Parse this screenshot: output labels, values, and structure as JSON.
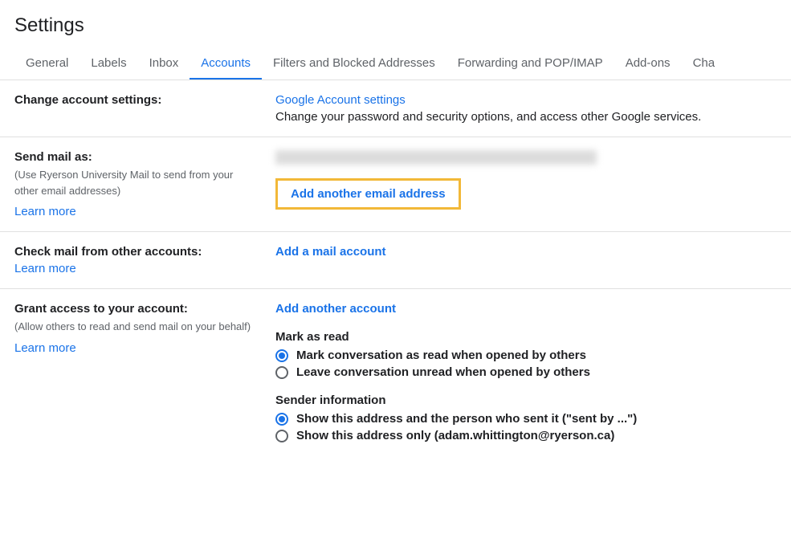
{
  "page_title": "Settings",
  "tabs": [
    {
      "label": "General",
      "active": false
    },
    {
      "label": "Labels",
      "active": false
    },
    {
      "label": "Inbox",
      "active": false
    },
    {
      "label": "Accounts",
      "active": true
    },
    {
      "label": "Filters and Blocked Addresses",
      "active": false
    },
    {
      "label": "Forwarding and POP/IMAP",
      "active": false
    },
    {
      "label": "Add-ons",
      "active": false
    },
    {
      "label": "Cha",
      "active": false
    }
  ],
  "change_account": {
    "title": "Change account settings:",
    "link": "Google Account settings",
    "desc": "Change your password and security options, and access other Google services."
  },
  "send_mail_as": {
    "title": "Send mail as:",
    "subtext": "(Use Ryerson University Mail to send from your other email addresses)",
    "learn_more": "Learn more",
    "add_link": "Add another email address"
  },
  "check_mail": {
    "title": "Check mail from other accounts:",
    "learn_more": "Learn more",
    "add_link": "Add a mail account"
  },
  "grant_access": {
    "title": "Grant access to your account:",
    "subtext": "(Allow others to read and send mail on your behalf)",
    "learn_more": "Learn more",
    "add_link": "Add another account",
    "mark_as_read": {
      "heading": "Mark as read",
      "options": [
        {
          "label": "Mark conversation as read when opened by others",
          "checked": true
        },
        {
          "label": "Leave conversation unread when opened by others",
          "checked": false
        }
      ]
    },
    "sender_info": {
      "heading": "Sender information",
      "options": [
        {
          "label": "Show this address and the person who sent it (\"sent by ...\")",
          "checked": true
        },
        {
          "label": "Show this address only (adam.whittington@ryerson.ca)",
          "checked": false
        }
      ]
    }
  }
}
